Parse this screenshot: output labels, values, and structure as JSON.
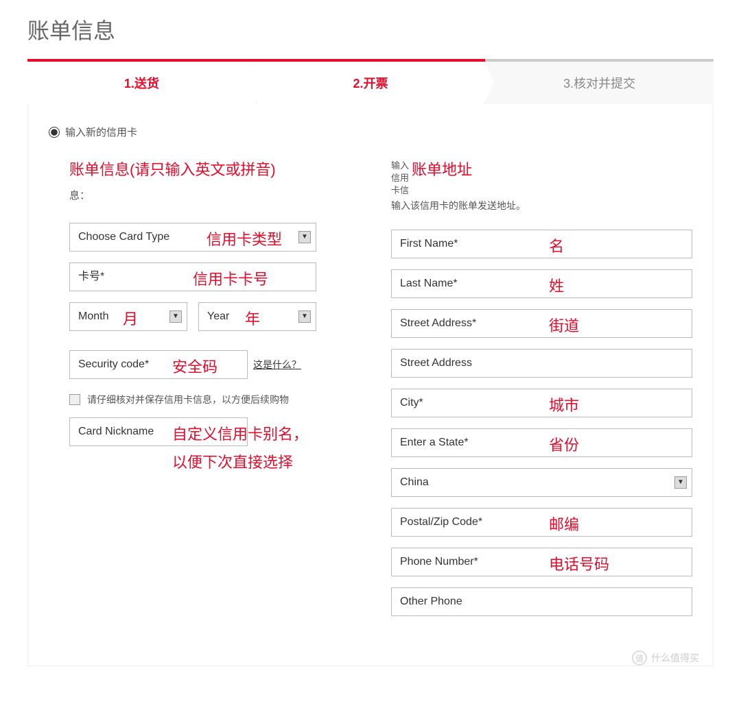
{
  "page_title": "账单信息",
  "steps": {
    "step1": "1.送货",
    "step2": "2.开票",
    "step3": "3.核对并提交"
  },
  "radio_label": "输入新的信用卡",
  "left": {
    "heading": "账单信息(请只输入英文或拼音)",
    "xi": "息：",
    "card_type_placeholder": "Choose Card Type",
    "card_number_placeholder": "卡号*",
    "month_placeholder": "Month",
    "year_placeholder": "Year",
    "security_code_placeholder": "Security code*",
    "what_is_this": "这是什么？",
    "save_checkbox": "请仔细核对并保存信用卡信息，以方便后续购物",
    "nickname_placeholder": "Card Nickname"
  },
  "right": {
    "pre_line1": "输入",
    "pre_line2": "信用",
    "pre_line3": "卡信",
    "heading": "账单地址",
    "subtext": "输入该信用卡的账单发送地址。",
    "first_name": "First Name*",
    "last_name": "Last Name*",
    "street1": "Street Address*",
    "street2": "Street Address",
    "city": "City*",
    "state": "Enter a State*",
    "country_value": "China",
    "postal": "Postal/Zip Code*",
    "phone": "Phone Number*",
    "other_phone": "Other Phone"
  },
  "annotations": {
    "card_type": "信用卡类型",
    "card_number": "信用卡卡号",
    "month": "月",
    "year": "年",
    "security": "安全码",
    "nickname_line1": "自定义信用卡别名，",
    "nickname_line2": "以便下次直接选择",
    "first_name": "名",
    "last_name": "姓",
    "street": "街道",
    "city": "城市",
    "state": "省份",
    "postal": "邮编",
    "phone": "电话号码"
  },
  "watermark": "什么值得买"
}
